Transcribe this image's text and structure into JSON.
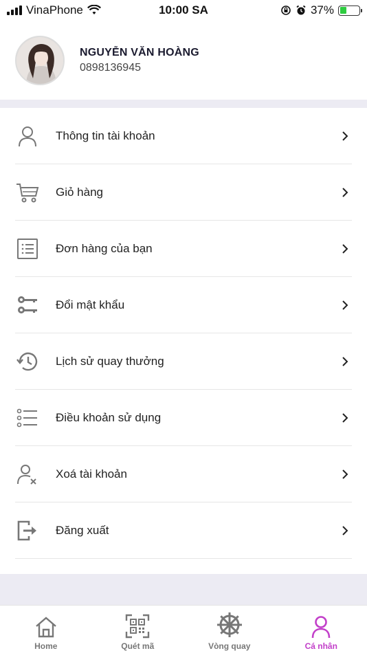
{
  "status_bar": {
    "carrier": "VinaPhone",
    "time": "10:00 SA",
    "battery_percent": "37%",
    "battery_level": 0.37
  },
  "profile": {
    "name": "NGUYỄN VĂN HOÀNG",
    "phone": "0898136945"
  },
  "menu": {
    "items": [
      {
        "label": "Thông tin tài khoản",
        "icon": "user-icon"
      },
      {
        "label": "Giỏ hàng",
        "icon": "cart-icon"
      },
      {
        "label": "Đơn hàng của bạn",
        "icon": "order-list-icon"
      },
      {
        "label": "Đổi mật khẩu",
        "icon": "key-icon"
      },
      {
        "label": "Lịch sử quay thưởng",
        "icon": "history-icon"
      },
      {
        "label": "Điều khoản sử dụng",
        "icon": "terms-list-icon"
      },
      {
        "label": "Xoá tài khoản",
        "icon": "user-remove-icon"
      },
      {
        "label": "Đăng xuất",
        "icon": "logout-icon"
      }
    ]
  },
  "tabs": [
    {
      "label": "Home",
      "icon": "home-icon",
      "active": false
    },
    {
      "label": "Quét mã",
      "icon": "qr-code-icon",
      "active": false
    },
    {
      "label": "Vòng quay",
      "icon": "wheel-icon",
      "active": false
    },
    {
      "label": "Cá nhân",
      "icon": "person-icon",
      "active": true
    }
  ],
  "colors": {
    "accent": "#c23ec9",
    "icon_gray": "#777777",
    "band": "#ecebf3"
  }
}
